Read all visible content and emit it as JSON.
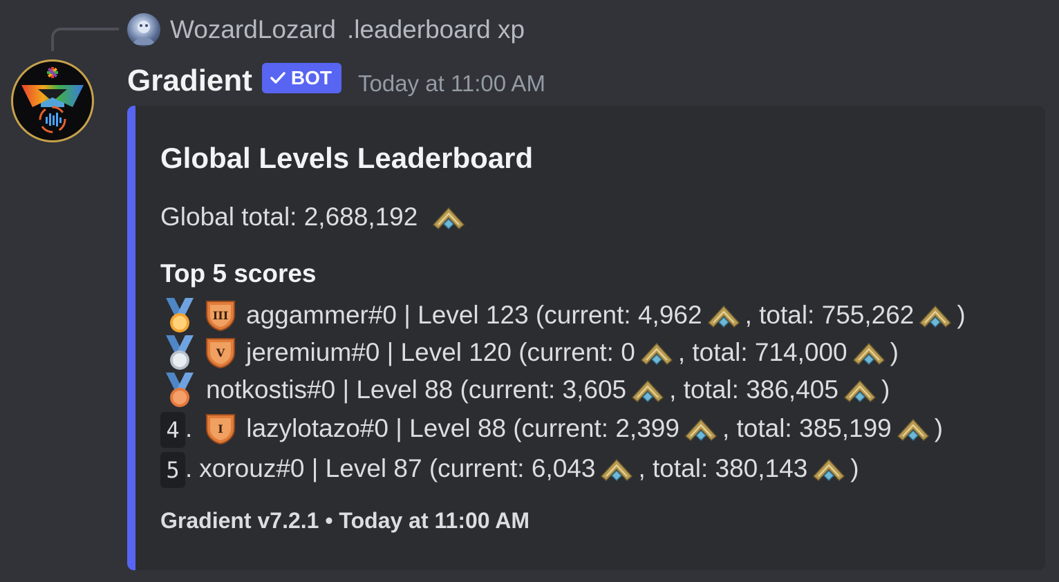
{
  "reply": {
    "username": "WozardLozard",
    "command": ".leaderboard xp"
  },
  "message": {
    "author": "Gradient",
    "bot_tag": "BOT",
    "timestamp": "Today at 11:00 AM"
  },
  "embed": {
    "accent_color": "#5865f2",
    "title": "Global Levels Leaderboard",
    "global_total_label": "Global total: 2,688,192",
    "top_heading": "Top 5 scores",
    "rows": [
      {
        "rank": "1",
        "medal": "gold",
        "shield": "III",
        "text_before_current": "aggammer#0 | Level 123 (current: 4,962",
        "text_before_total": ", total: 755,262",
        "closing": ")"
      },
      {
        "rank": "2",
        "medal": "silver",
        "shield": "V",
        "text_before_current": "jeremium#0 | Level 120 (current: 0",
        "text_before_total": ", total: 714,000",
        "closing": ")"
      },
      {
        "rank": "3",
        "medal": "bronze",
        "shield": "",
        "text_before_current": "notkostis#0 | Level 88 (current: 3,605",
        "text_before_total": ", total: 386,405",
        "closing": ")"
      },
      {
        "rank": "4",
        "rank_suffix": ".",
        "shield": "I",
        "text_before_current": "lazylotazo#0 | Level 88 (current: 2,399",
        "text_before_total": ", total: 385,199",
        "closing": ")"
      },
      {
        "rank": "5",
        "rank_suffix": ".",
        "shield": "",
        "text_before_current": "xorouz#0 | Level 87 (current: 6,043",
        "text_before_total": ", total: 380,143",
        "closing": ")"
      }
    ],
    "footer": "Gradient v7.2.1 • Today at 11:00 AM"
  },
  "icons": {
    "xp": "xp-chevron-icon",
    "medals": [
      "gold-medal-icon",
      "silver-medal-icon",
      "bronze-medal-icon"
    ],
    "shield": "rank-shield-icon"
  }
}
